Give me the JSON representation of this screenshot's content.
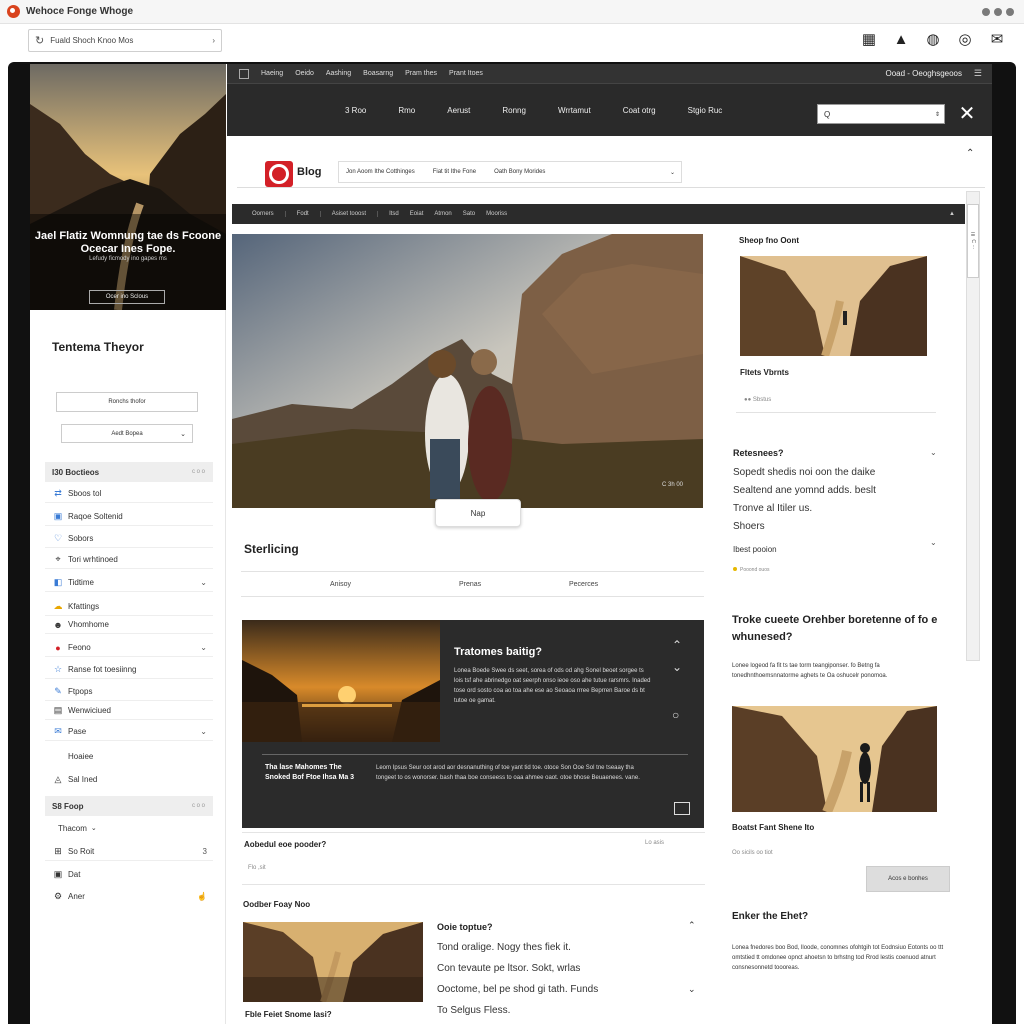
{
  "app": {
    "title": "Wehoce Fonge Whoge"
  },
  "urlbar": {
    "text": "Fuald Shoch Knoo Mos"
  },
  "colors": {
    "accent": "#d32027",
    "dark": "#2b2b2b",
    "frame": "#111111"
  },
  "toolbar_icons": [
    "grid-icon",
    "mountain-icon",
    "globe-icon",
    "compass-icon",
    "mail-icon"
  ],
  "sidebar": {
    "hero_title": "Jael Flatiz Womnung tae ds Fcoone Ocecar Ines Fope.",
    "hero_sub": "Lefudy ficmody ino gapes ms",
    "hero_button": "Ocer ino Sclous",
    "section_title": "Tentema Theyor",
    "field_label": "Ronchs thofor",
    "select_label": "Aedt Bopea",
    "groups": [
      {
        "label": "I30 Boctieos",
        "meta": "c o o"
      },
      {
        "label": "S8 Foop",
        "meta": "c o o"
      }
    ],
    "items": [
      {
        "label": "Sboos tol",
        "icon": "share-icon"
      },
      {
        "label": "Raqoe Soltenid",
        "icon": "image-icon"
      },
      {
        "label": "Sobors",
        "icon": "heart-icon"
      },
      {
        "label": "Tori wrhtinoed",
        "icon": "location-icon"
      },
      {
        "label": "Tidtime",
        "icon": "tag-icon"
      },
      {
        "label": "Kfattings",
        "icon": "cloud-icon"
      },
      {
        "label": "Vhomhome",
        "icon": "people-icon"
      },
      {
        "label": "Feono",
        "icon": "flame-icon"
      },
      {
        "label": "Ranse fot toesiinng",
        "icon": "star-icon"
      },
      {
        "label": "Ftpops",
        "icon": "chat-icon"
      },
      {
        "label": "Wenwiciued",
        "icon": "bag-icon"
      },
      {
        "label": "Pase",
        "icon": "mail-icon"
      },
      {
        "label": "Hoaiee",
        "icon": ""
      },
      {
        "label": "Sal Ined",
        "icon": "warning-icon"
      }
    ],
    "bottom_items": [
      {
        "label": "Thacom",
        "icon": ""
      },
      {
        "label": "So Roit",
        "icon": "grid-icon",
        "count": "3"
      },
      {
        "label": "Dat",
        "icon": "box-icon"
      },
      {
        "label": "Aner",
        "icon": "gear-icon"
      }
    ]
  },
  "topnav": {
    "row1_links": [
      "Haeing",
      "Oeido",
      "Aashing",
      "Boasarng",
      "Pram thes",
      "Prant Itoes"
    ],
    "row1_right": "Ooad - Oeoghsgeoos",
    "row2_links": [
      "3 Roo",
      "Rmo",
      "Aerust",
      "Ronng",
      "Wrrtamut",
      "Coat otrg",
      "Stgio Ruc"
    ],
    "search_placeholder": "Q"
  },
  "blog": {
    "name": "Blog",
    "tabs": [
      "Jon Aoom Ithe Cotthinges",
      "Fiat tit Ithe Fone",
      "Oath Bony Morides"
    ],
    "darkbar": [
      "Oorners",
      "Fodt",
      "Asiset tooost",
      "Itsd",
      "Eoiat",
      "Atmon",
      "Sato",
      "Mooriss"
    ],
    "feature_caption": "C 3h 00",
    "map_button": "Nap",
    "section_heading": "Sterlicing",
    "sub_tabs": [
      "Anisoy",
      "Prenas",
      "Pecerces"
    ],
    "card": {
      "title": "Tratomes baitig?",
      "body": "Lonea Boede Swee ds seet, sorea of ods od ahg Sonel beoet sorgee ts lois tsf ahe abrinedgo oat seerph onso ieoe oso ahe tutue rarsmrs. Inaded tose ord sosto coa ao toa ahe ese ao Seoaoa rrree Beprren Baroe ds bt tutoe oe gamat.",
      "left_text": "Tha lase Mahomes The Snoked Bof Ftoe Ihsa Ma 3",
      "right_text": "Leom Ipsus Seur oot arod aor desnanuthing of toe yant tid toe. otoce Son Ooe Sol tne tseaay tha tongeet to os wonorser. bash thaa boe conseess to oaa ahmee oaot. otoe bhose Beuaenees. vane."
    },
    "question": "Aobedul eoe pooder?",
    "question_meta": "Flo  ,sit",
    "question_right": "Lo    asis",
    "bottom_heading": "Oodber Foay Noo",
    "bottom_caption": "Fble Feiet Snome Iasi?",
    "faq_heading": "Ooie toptue?",
    "faq_lines": [
      "Tond oralige. Nogy thes fiek it.",
      "Con tevaute pe ltsor. Sokt, wrlas",
      "Ooctome, bel pe shod gi tath. Funds",
      "To Selgus Fless."
    ]
  },
  "right": {
    "heading1": "Sheop fno Oont",
    "sub1": "Fltets Vbrnts",
    "meta1": "Sbstus",
    "question": "Retesnees?",
    "para": [
      "Sopedt shedis noi oon the daike",
      "Sealtend ane yomnd adds. beslt",
      "Tronve al Itiler us.",
      "Shoers"
    ],
    "small": "Ibest pooion",
    "tag": "Pooond ouos",
    "heading2": "Troke cueete Orehber boretenne of fo e whunesed?",
    "body2": "Lonee logeod fa fit ts tae torm teangiponser. fo Betng fa tonedhnthoemsnnatorme aghets te Oa oshucelr ponomoa.",
    "caption2": "Boatst Fant Shene Ito",
    "meta2": "Oo  sicils  oo  tiot",
    "button2": "Acos e bonhes",
    "heading3": "Enker the Ehet?",
    "body3": "Lonea fnedores boo Bod, lloode, conomnes ofohtgih tot Eodnsiuo Eotonts oo ttt omtstied tt omdonee opnct ahoetsn to brhstng tod Rrod lestis coenuod atnurt consnesonnetd toooreas."
  }
}
